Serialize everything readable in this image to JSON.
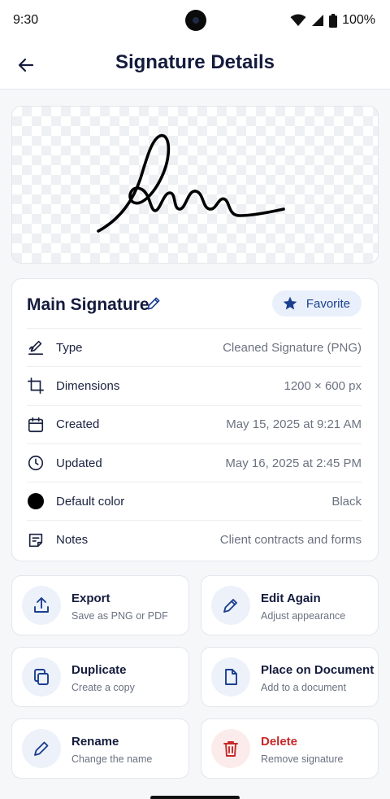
{
  "status_bar": {
    "time": "9:30",
    "battery": "100%"
  },
  "header": {
    "title": "Signature Details"
  },
  "signature": {
    "name": "Main Signature",
    "favorite_label": "Favorite"
  },
  "details": [
    {
      "icon": "signature-pen-icon",
      "label": "Type",
      "value": "Cleaned Signature (PNG)"
    },
    {
      "icon": "crop-icon",
      "label": "Dimensions",
      "value": "1200 × 600 px"
    },
    {
      "icon": "calendar-icon",
      "label": "Created",
      "value": "May 15, 2025 at 9:21 AM"
    },
    {
      "icon": "clock-icon",
      "label": "Updated",
      "value": "May 16, 2025 at 2:45 PM"
    },
    {
      "icon": "color-dot-icon",
      "label": "Default color",
      "value": "Black"
    },
    {
      "icon": "note-icon",
      "label": "Notes",
      "value": "Client contracts and forms"
    }
  ],
  "actions": [
    {
      "icon": "export-icon",
      "title": "Export",
      "subtitle": "Save as PNG or PDF"
    },
    {
      "icon": "pen-icon",
      "title": "Edit Again",
      "subtitle": "Adjust appearance"
    },
    {
      "icon": "duplicate-icon",
      "title": "Duplicate",
      "subtitle": "Create a copy"
    },
    {
      "icon": "document-icon",
      "title": "Place on Document",
      "subtitle": "Add to a document"
    },
    {
      "icon": "pencil-icon",
      "title": "Rename",
      "subtitle": "Change the name"
    },
    {
      "icon": "trash-icon",
      "title": "Delete",
      "subtitle": "Remove signature"
    }
  ],
  "colors": {
    "primary": "#1b3f8f",
    "title": "#141b3d",
    "danger": "#c62828",
    "default_signature_color": "#000000"
  }
}
